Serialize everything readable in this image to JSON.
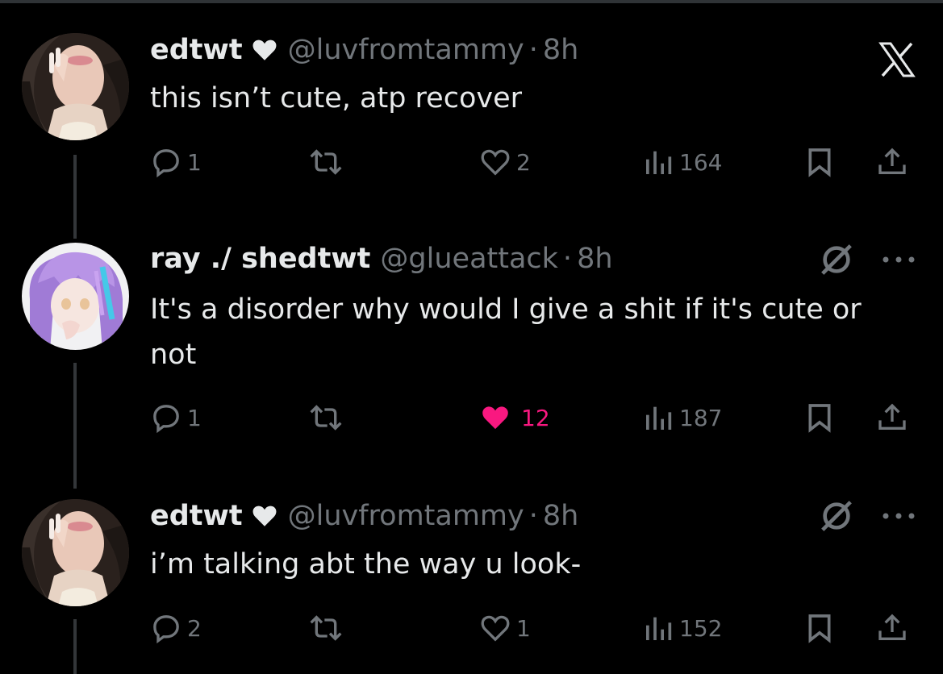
{
  "tweets": [
    {
      "display_name": "edtwt",
      "badge_icon": "white-heart-icon",
      "handle": "@luvfromtammy",
      "separator": "·",
      "time": "8h",
      "text": "this isn’t cute, atp recover",
      "replies": "1",
      "likes": "2",
      "liked": false,
      "views": "164",
      "header_icon": "x-logo-icon"
    },
    {
      "display_name": "ray ./ shedtwt",
      "handle": "@glueattack",
      "separator": "·",
      "time": "8h",
      "text": "It's a disorder why would I give a shit if it's cute or not",
      "replies": "1",
      "likes": "12",
      "liked": true,
      "views": "187",
      "header_icon": "grok-icon"
    },
    {
      "display_name": "edtwt",
      "badge_icon": "white-heart-icon",
      "handle": "@luvfromtammy",
      "separator": "·",
      "time": "8h",
      "text": "i’m talking abt the way u look-",
      "replies": "2",
      "likes": "1",
      "liked": false,
      "views": "152",
      "header_icon": "grok-icon"
    }
  ],
  "colors": {
    "background": "#000000",
    "text_primary": "#e7e9ea",
    "text_secondary": "#71767b",
    "like_active": "#f91880",
    "thread_line": "#333639"
  }
}
